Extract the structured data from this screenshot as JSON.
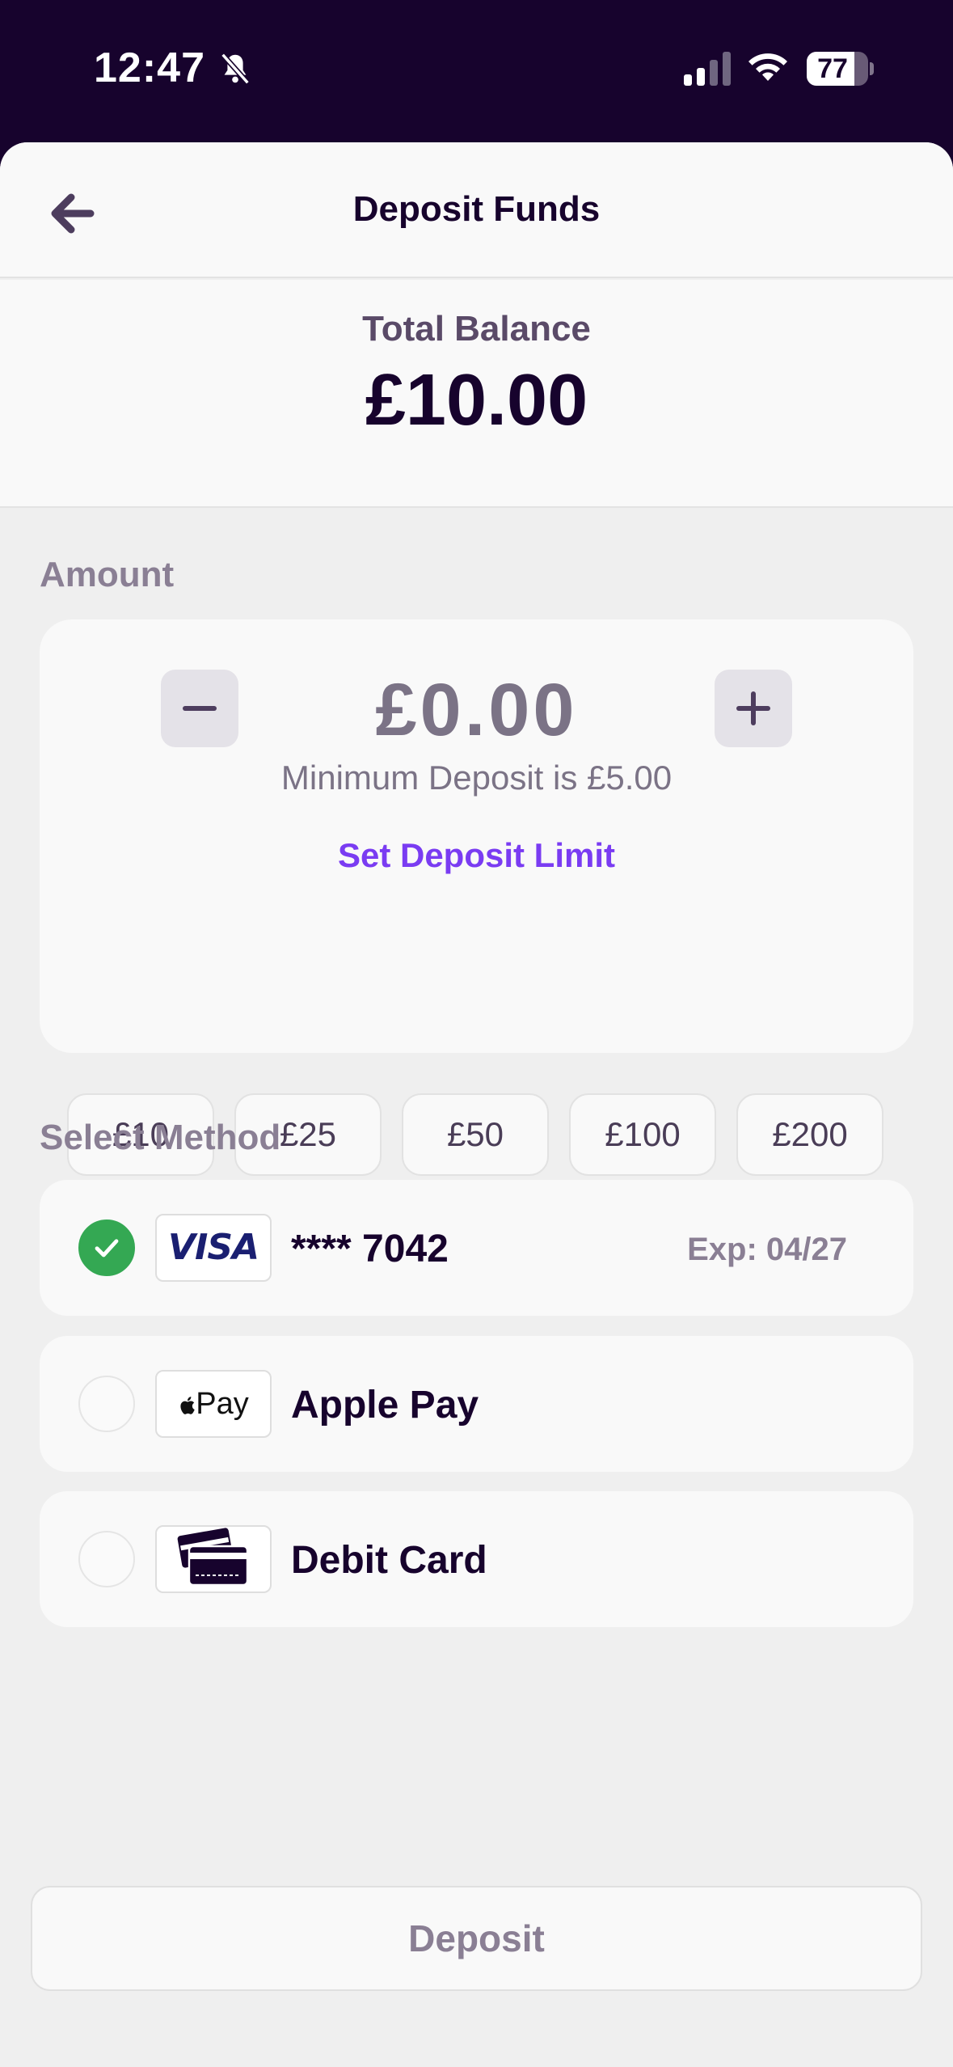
{
  "status_bar": {
    "time": "12:47",
    "battery": "77",
    "battery_level": 0.77
  },
  "header": {
    "title": "Deposit Funds",
    "back_icon": "arrow-left-icon"
  },
  "balance": {
    "label": "Total Balance",
    "value": "£10.00"
  },
  "amount": {
    "section_label": "Amount",
    "value": "£0.00",
    "minimum_note": "Minimum Deposit is £5.00",
    "limit_link": "Set Deposit Limit",
    "quick_amounts": [
      "£10",
      "£25",
      "£50",
      "£100",
      "£200"
    ]
  },
  "methods": {
    "section_label": "Select Method",
    "items": [
      {
        "logo": "VISA",
        "label": "**** 7042",
        "expiry": "Exp: 04/27",
        "selected": true
      },
      {
        "logo": "Pay",
        "label": "Apple Pay",
        "selected": false
      },
      {
        "logo": "credit-card-icon",
        "label": "Debit Card",
        "selected": false
      }
    ]
  },
  "deposit_button": "Deposit",
  "colors": {
    "brand_dark": "#17032d",
    "accent": "#7a3cf2",
    "success": "#34a853"
  }
}
